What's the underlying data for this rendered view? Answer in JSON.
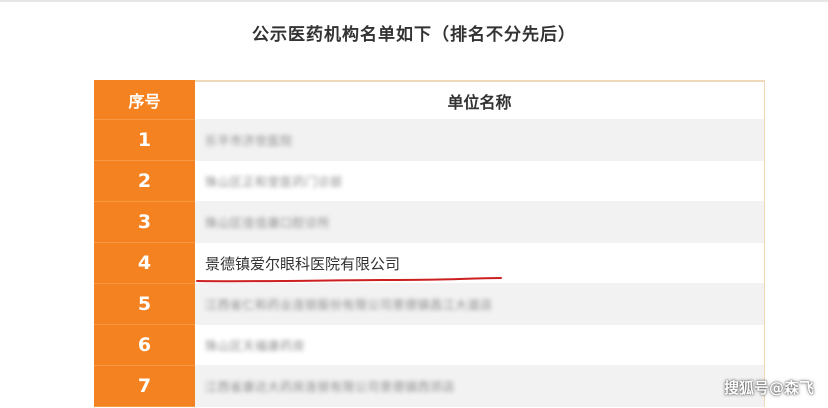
{
  "title": "公示医药机构名单如下（排名不分先后）",
  "table": {
    "headers": {
      "index": "序号",
      "name": "单位名称"
    },
    "rows": [
      {
        "index": "1",
        "name": "乐平市济世医院",
        "blurred": true
      },
      {
        "index": "2",
        "name": "珠山区正和堂医药门诊部",
        "blurred": true
      },
      {
        "index": "3",
        "name": "珠山区佳佳康口腔诊所",
        "blurred": true
      },
      {
        "index": "4",
        "name": "景德镇爱尔眼科医院有限公司",
        "blurred": false
      },
      {
        "index": "5",
        "name": "江西省仁和药业连锁股份有限公司景德镇昌江大道店",
        "blurred": true
      },
      {
        "index": "6",
        "name": "珠山区天福康药房",
        "blurred": true
      },
      {
        "index": "7",
        "name": "江西省康达大药房连锁有限公司景德镇西郊店",
        "blurred": true
      }
    ]
  },
  "watermark": "搜狐号@森飞",
  "colors": {
    "accent": "#f58220",
    "underline": "#cc1f1f"
  }
}
